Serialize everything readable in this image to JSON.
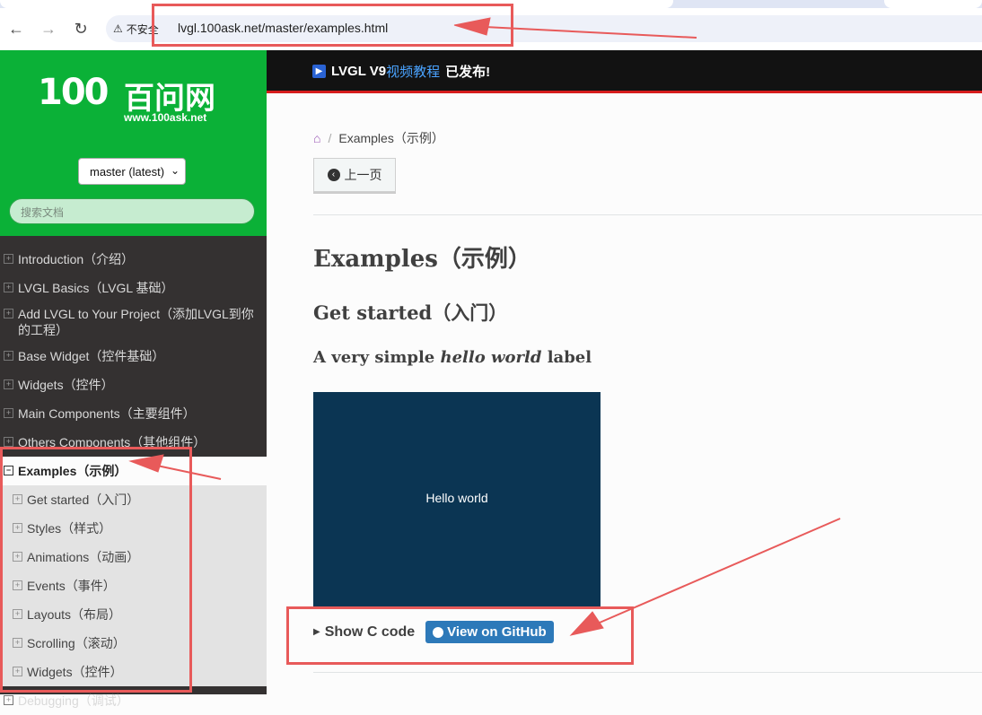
{
  "browser": {
    "back_icon": "arrow-left-icon",
    "forward_icon": "arrow-right-icon",
    "reload_icon": "reload-icon",
    "security_label": "不安全",
    "url": "lvgl.100ask.net/master/examples.html"
  },
  "sidebar": {
    "logo_mark": "100",
    "logo_cn": "百问网",
    "logo_site": "www.100ask.net",
    "version": "master (latest)",
    "search_placeholder": "搜索文档",
    "items": [
      {
        "label": "Introduction（介绍）"
      },
      {
        "label": "LVGL Basics（LVGL 基础）"
      },
      {
        "label": "Add LVGL to Your Project（添加LVGL到你的工程）"
      },
      {
        "label": "Base Widget（控件基础）"
      },
      {
        "label": "Widgets（控件）"
      },
      {
        "label": "Main Components（主要组件）"
      },
      {
        "label": "Others Components（其他组件）"
      },
      {
        "label": "Examples（示例）"
      }
    ],
    "sub_items": [
      {
        "label": "Get started（入门）"
      },
      {
        "label": "Styles（样式）"
      },
      {
        "label": "Animations（动画）"
      },
      {
        "label": "Events（事件）"
      },
      {
        "label": "Layouts（布局）"
      },
      {
        "label": "Scrolling（滚动）"
      },
      {
        "label": "Widgets（控件）"
      }
    ],
    "last_item": "Debugging（调试）"
  },
  "topbar": {
    "prefix": "LVGL V9",
    "link": "视频教程",
    "suffix": "已发布!"
  },
  "content": {
    "breadcrumb": "Examples（示例）",
    "prev_button": "上一页",
    "h1": "Examples（示例）",
    "h2": "Get started（入门）",
    "h3_pre": "A very simple ",
    "h3_em": "hello world",
    "h3_post": " label",
    "demo_label": "Hello world",
    "show_code": "Show C code",
    "github_button": "View on GitHub"
  },
  "colors": {
    "brand_green": "#0bb137",
    "sidebar_bg": "#343131",
    "annotation_red": "#e85a5a",
    "demo_bg": "#0b3553",
    "github_blue": "#2d79b9"
  }
}
